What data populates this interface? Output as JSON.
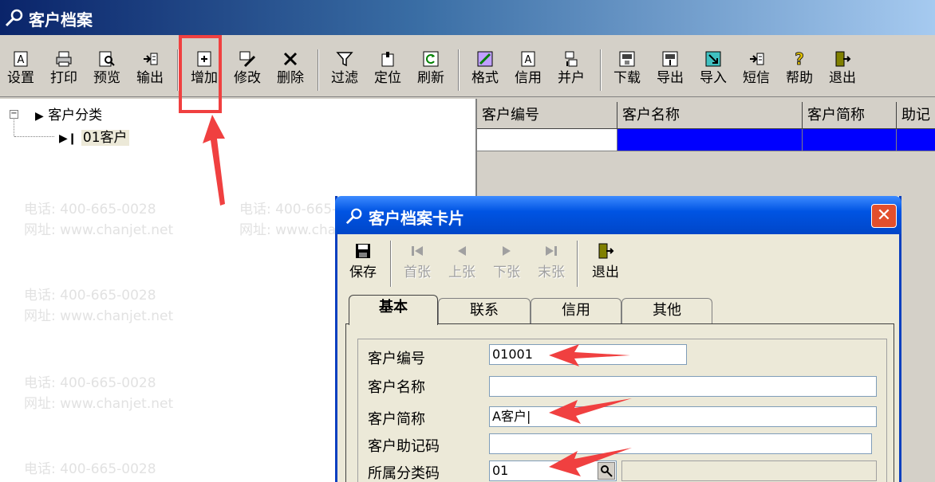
{
  "window": {
    "title": "客户档案"
  },
  "toolbar": {
    "buttons": [
      {
        "label": "设置",
        "icon": "setup-icon"
      },
      {
        "label": "打印",
        "icon": "printer-icon"
      },
      {
        "label": "预览",
        "icon": "preview-icon"
      },
      {
        "label": "输出",
        "icon": "output-icon"
      },
      {
        "label": "增加",
        "icon": "add-icon"
      },
      {
        "label": "修改",
        "icon": "edit-icon"
      },
      {
        "label": "删除",
        "icon": "delete-icon"
      },
      {
        "label": "过滤",
        "icon": "filter-icon"
      },
      {
        "label": "定位",
        "icon": "locate-icon"
      },
      {
        "label": "刷新",
        "icon": "refresh-icon"
      },
      {
        "label": "格式",
        "icon": "format-icon"
      },
      {
        "label": "信用",
        "icon": "credit-icon"
      },
      {
        "label": "并户",
        "icon": "merge-icon"
      },
      {
        "label": "下载",
        "icon": "download-icon"
      },
      {
        "label": "导出",
        "icon": "export-icon"
      },
      {
        "label": "导入",
        "icon": "import-icon"
      },
      {
        "label": "短信",
        "icon": "sms-icon"
      },
      {
        "label": "帮助",
        "icon": "help-icon"
      },
      {
        "label": "退出",
        "icon": "exit-icon"
      }
    ]
  },
  "tree": {
    "root": "客户分类",
    "child": "01客户"
  },
  "grid": {
    "columns": [
      "客户编号",
      "客户名称",
      "客户简称",
      "助记"
    ]
  },
  "watermark": {
    "phone": "电话: 400-665-0028",
    "site": "网址: www.chanjet.net"
  },
  "dialog": {
    "title": "客户档案卡片",
    "close": "✕",
    "toolbar": [
      {
        "label": "保存",
        "icon": "save-icon",
        "enabled": true
      },
      {
        "label": "首张",
        "icon": "first-record-icon",
        "enabled": false
      },
      {
        "label": "上张",
        "icon": "previous-record-icon",
        "enabled": false
      },
      {
        "label": "下张",
        "icon": "next-record-icon",
        "enabled": false
      },
      {
        "label": "末张",
        "icon": "last-record-icon",
        "enabled": false
      },
      {
        "label": "退出",
        "icon": "exit-icon",
        "enabled": true
      }
    ],
    "tabs": [
      "基本",
      "联系",
      "信用",
      "其他"
    ],
    "active_tab": "基本",
    "fields": {
      "code_label": "客户编号",
      "code_value": "01001",
      "name_label": "客户名称",
      "name_value": "",
      "short_label": "客户简称",
      "short_value": "A客户|",
      "mnemonic_label": "客户助记码",
      "mnemonic_value": "",
      "category_label": "所属分类码",
      "category_value": "01"
    }
  },
  "colors": {
    "annotation_red": "#f04040",
    "grid_selection": "#0000ff"
  }
}
